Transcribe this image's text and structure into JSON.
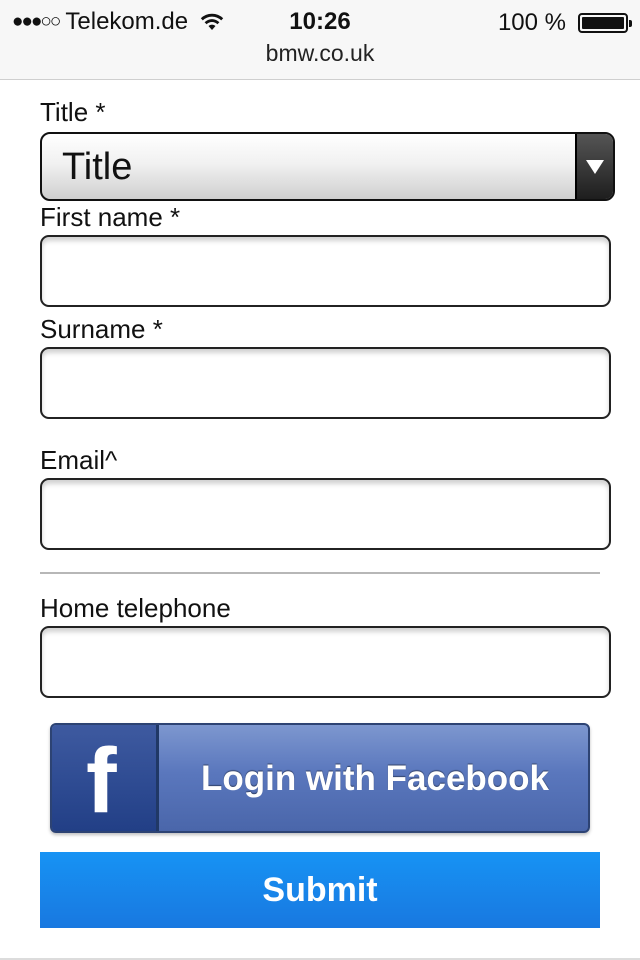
{
  "status_bar": {
    "signal": "●●●○○",
    "carrier": "Telekom.de",
    "time": "10:26",
    "battery_text": "100 %",
    "battery_level_percent": 100,
    "url": "bmw.co.uk"
  },
  "form": {
    "title_label": "Title *",
    "title_value": "Title",
    "first_name_label": "First name *",
    "first_name_value": "",
    "surname_label": "Surname *",
    "surname_value": "",
    "email_label": "Email^",
    "email_value": "",
    "home_phone_label": "Home telephone",
    "home_phone_value": ""
  },
  "buttons": {
    "facebook_label": "Login with Facebook",
    "facebook_icon_letter": "f",
    "submit_label": "Submit"
  },
  "colors": {
    "facebook": "#4a66aa",
    "submit": "#1878e0"
  }
}
